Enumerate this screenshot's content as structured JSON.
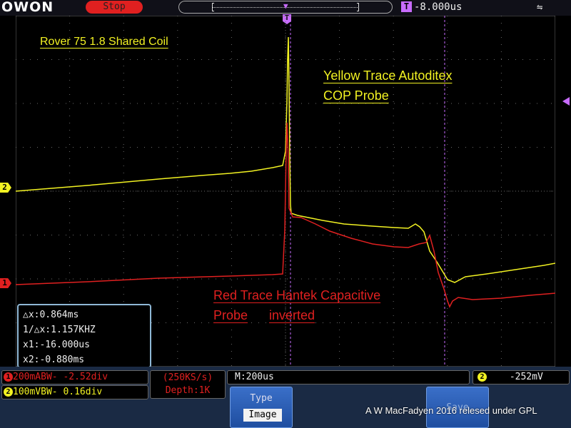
{
  "header": {
    "brand": "OWON",
    "run_state": "Stop",
    "trigger_marker": "T",
    "trigger_time": "-8.000us",
    "usb_icon": "usb-icon"
  },
  "channel_markers": {
    "ch2": "2",
    "ch1": "1"
  },
  "annotations": {
    "title": "Rover 75 1.8 Shared Coil",
    "yellow_line1": "Yellow Trace Autoditex",
    "yellow_line2": "COP Probe",
    "red_line1": "Red Trace Hantek Capacitive",
    "red_line2a": "Probe",
    "red_line2b": "inverted"
  },
  "cursor": {
    "dx": "△x:0.864ms",
    "inv_dx": "1/△x:1.157KHZ",
    "x1": "x1:-16.000us",
    "x2": "x2:-0.880ms"
  },
  "status": {
    "ch1_num": "1",
    "ch1_setting": "200mABW- -2.52div",
    "ch2_num": "2",
    "ch2_setting": "100mVBW- 0.16div",
    "sample_rate": "(250KS/s)",
    "depth": "Depth:1K",
    "timebase": "M:200us",
    "trigger_ch": "2",
    "trigger_level": "-252mV"
  },
  "menu": {
    "type_label": "Type",
    "type_value": "Image",
    "save_label": "Save"
  },
  "credit": "A W MacFadyen 2016  relesed under GPL",
  "colors": {
    "ch1": "#e02020",
    "ch2": "#f2f222",
    "trigger": "#c86cff",
    "grid": "#6a6a6a"
  }
}
